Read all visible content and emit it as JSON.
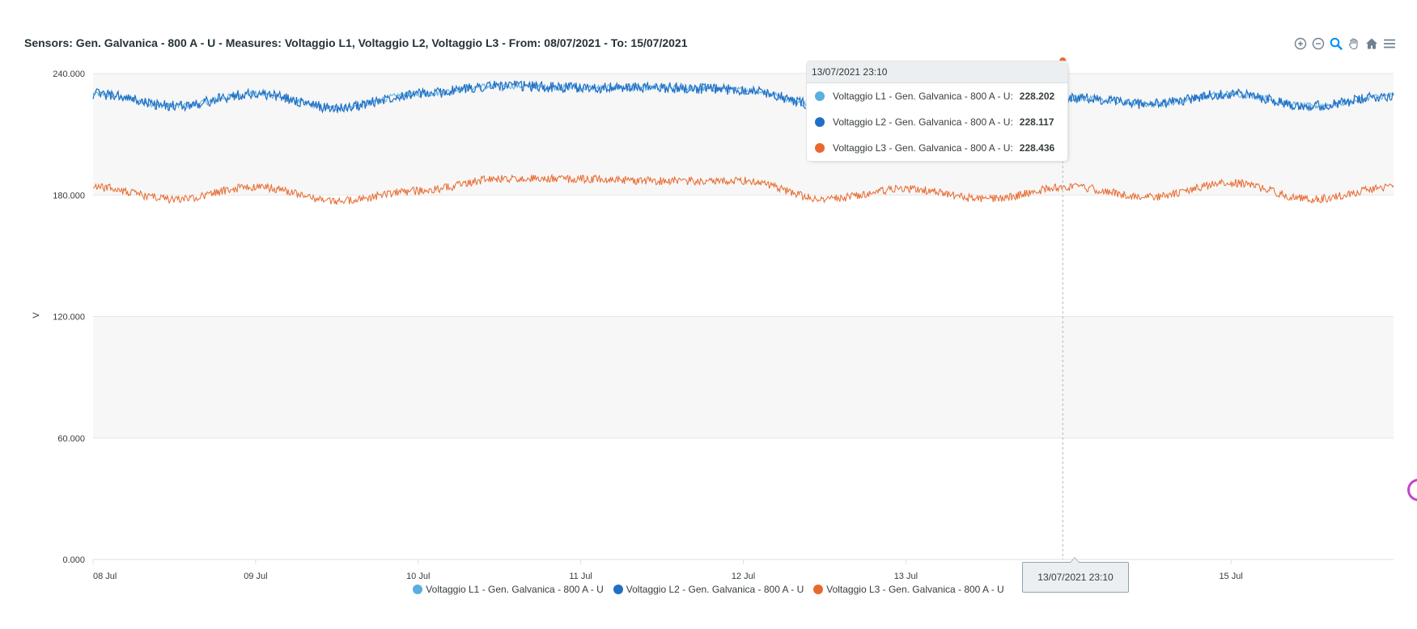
{
  "header": {
    "title": "Sensors: Gen. Galvanica - 800 A - U - Measures: Voltaggio L1, Voltaggio L2, Voltaggio L3 - From: 08/07/2021 - To: 15/07/2021"
  },
  "toolbar": {
    "buttons": [
      {
        "icon": "zoom-in-icon"
      },
      {
        "icon": "zoom-out-icon"
      },
      {
        "icon": "zoom-selection-icon"
      },
      {
        "icon": "pan-hand-icon"
      },
      {
        "icon": "home-reset-icon"
      },
      {
        "icon": "menu-icon"
      }
    ],
    "icon_color": "#6e8192",
    "active_color": "#008ffb"
  },
  "tooltip": {
    "title": "13/07/2021 23:10",
    "rows": [
      {
        "label": "Voltaggio L1 - Gen. Galvanica - 800 A - U:",
        "value": "228.202",
        "color": "#5aaee0"
      },
      {
        "label": "Voltaggio L2 - Gen. Galvanica - 800 A - U:",
        "value": "228.117",
        "color": "#1f6fc5"
      },
      {
        "label": "Voltaggio L3 - Gen. Galvanica - 800 A - U:",
        "value": "228.436",
        "color": "#e8692e"
      }
    ]
  },
  "xaxis_tooltip": "13/07/2021 23:10",
  "chart_data": {
    "type": "line",
    "ylabel": "V",
    "ylim": [
      0,
      240
    ],
    "yticks": [
      "0.000",
      "60.000",
      "120.000",
      "180.000",
      "240.000"
    ],
    "xlim": [
      "2021-07-08 00:00",
      "2021-07-16 00:00"
    ],
    "xticks": [
      {
        "label": "08 Jul",
        "x": "2021-07-08"
      },
      {
        "label": "09 Jul",
        "x": "2021-07-09"
      },
      {
        "label": "10 Jul",
        "x": "2021-07-10"
      },
      {
        "label": "11 Jul",
        "x": "2021-07-11"
      },
      {
        "label": "12 Jul",
        "x": "2021-07-12"
      },
      {
        "label": "13 Jul",
        "x": "2021-07-13"
      },
      {
        "label": "15 Jul",
        "x": "2021-07-15"
      }
    ],
    "grid": true,
    "legend_position": "bottom",
    "crosshair_x": "2021-07-13 23:10",
    "x": [
      "2021-07-08",
      "2021-07-08 12:00",
      "2021-07-09",
      "2021-07-09 12:00",
      "2021-07-10",
      "2021-07-10 12:00",
      "2021-07-11",
      "2021-07-11 12:00",
      "2021-07-12",
      "2021-07-12 12:00",
      "2021-07-13",
      "2021-07-13 12:00",
      "2021-07-14",
      "2021-07-14 12:00",
      "2021-07-15",
      "2021-07-15 12:00",
      "2021-07-16"
    ],
    "series": [
      {
        "name": "Voltaggio L1 - Gen. Galvanica - 800 A - U",
        "color": "#5aaee0",
        "values": [
          230,
          224,
          230,
          223,
          230,
          234,
          233,
          233,
          232,
          224,
          226,
          225,
          228,
          225,
          230,
          224,
          229
        ]
      },
      {
        "name": "Voltaggio L2 - Gen. Galvanica - 800 A - U",
        "color": "#1f6fc5",
        "values": [
          230,
          224,
          230,
          223,
          230,
          234,
          233,
          233,
          232,
          224,
          226,
          225,
          228,
          225,
          230,
          224,
          229
        ]
      },
      {
        "name": "Voltaggio L3 - Gen. Galvanica - 800 A - U",
        "color": "#e8692e",
        "values": [
          184,
          178,
          184,
          177,
          182,
          188,
          188,
          187,
          187,
          178,
          183,
          178,
          184,
          179,
          186,
          178,
          184
        ]
      }
    ]
  }
}
